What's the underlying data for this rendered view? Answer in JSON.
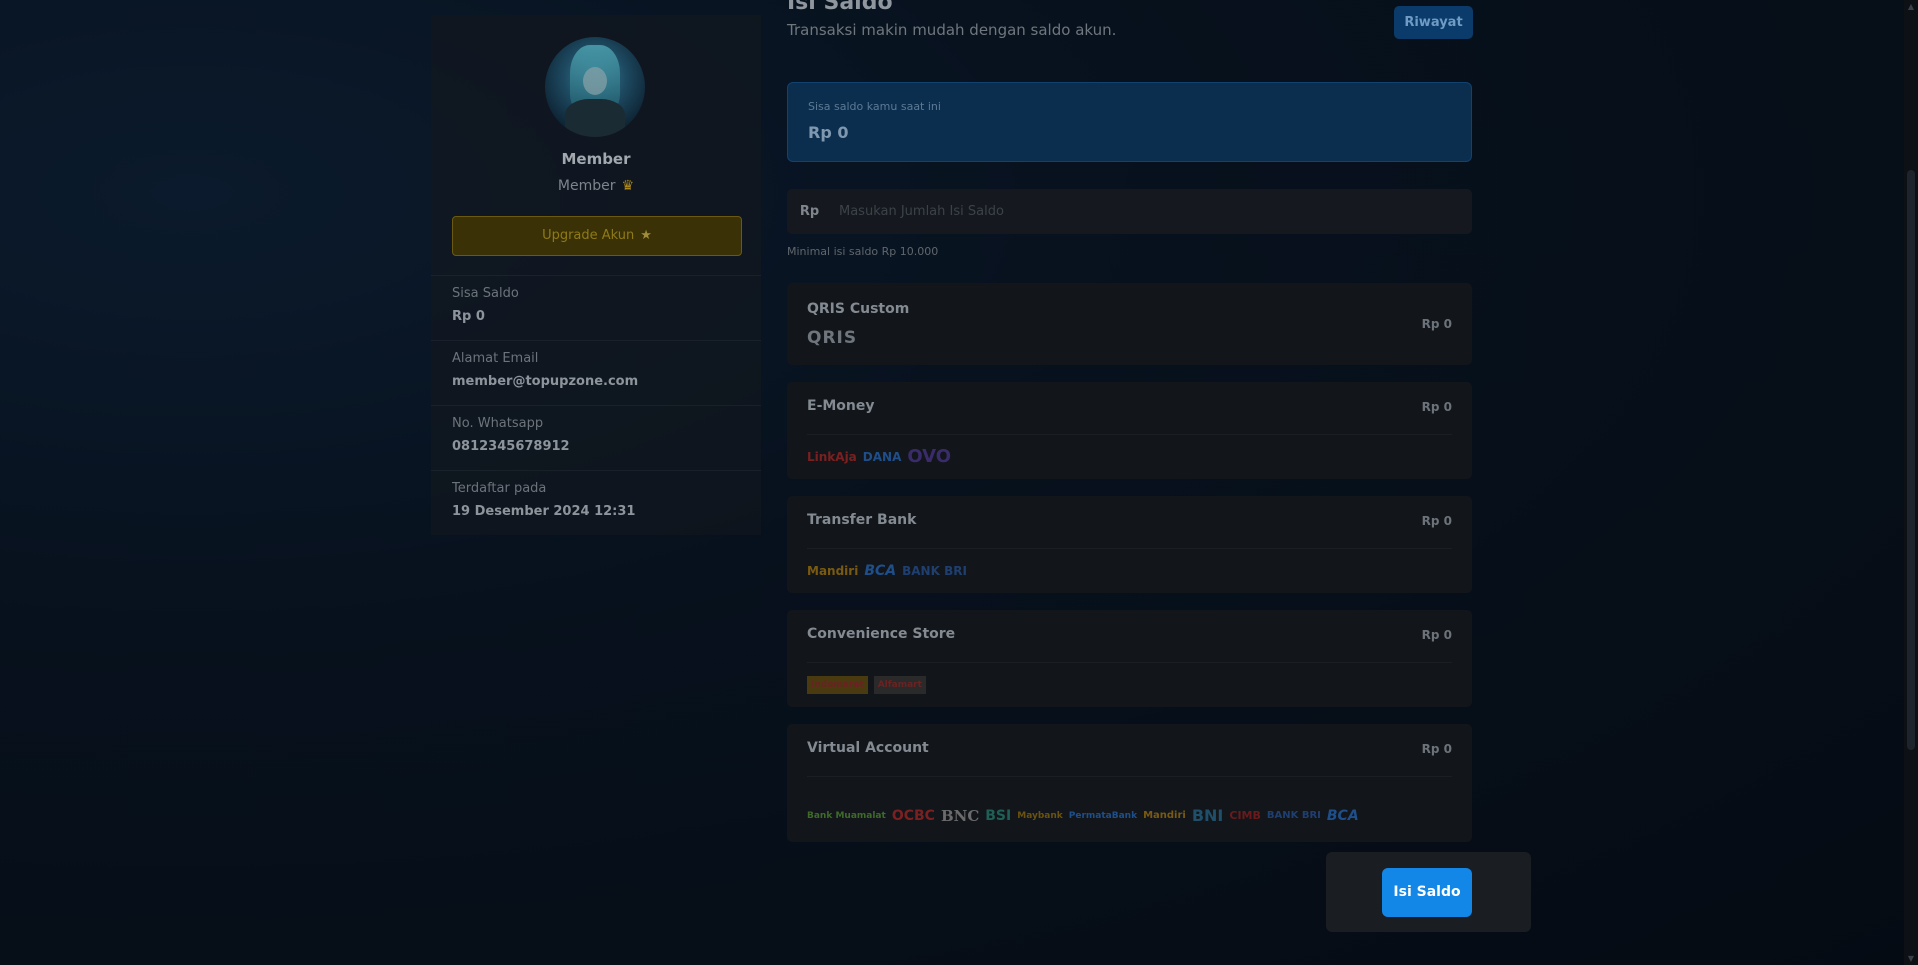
{
  "profile": {
    "name": "Member",
    "role": "Member",
    "upgrade_label": "Upgrade Akun",
    "info": [
      {
        "label": "Sisa Saldo",
        "value": "Rp 0"
      },
      {
        "label": "Alamat Email",
        "value": "member@topupzone.com"
      },
      {
        "label": "No. Whatsapp",
        "value": "0812345678912"
      },
      {
        "label": "Terdaftar pada",
        "value": "19 Desember 2024 12:31"
      }
    ]
  },
  "header": {
    "title": "Isi Saldo",
    "subtitle": "Transaksi makin mudah dengan saldo akun.",
    "history_label": "Riwayat"
  },
  "balance": {
    "label": "Sisa saldo kamu saat ini",
    "value": "Rp 0"
  },
  "amount": {
    "prefix": "Rp",
    "placeholder": "Masukan Jumlah Isi Saldo",
    "value": "",
    "min_note": "Minimal isi saldo Rp 10.000"
  },
  "methods": [
    {
      "title": "QRIS Custom",
      "price": "Rp 0",
      "logos": [
        "QRIS"
      ]
    },
    {
      "title": "E-Money",
      "price": "Rp 0",
      "logos": [
        "LinkAja",
        "DANA",
        "OVO"
      ]
    },
    {
      "title": "Transfer Bank",
      "price": "Rp 0",
      "logos": [
        "Mandiri",
        "BCA",
        "BANK BRI"
      ]
    },
    {
      "title": "Convenience Store",
      "price": "Rp 0",
      "logos": [
        "Indomaret",
        "Alfamart"
      ]
    },
    {
      "title": "Virtual Account",
      "price": "Rp 0",
      "logos": [
        "Bank Muamalat",
        "OCBC",
        "BNC",
        "BSI",
        "Maybank",
        "PermataBank",
        "Mandiri",
        "BNI",
        "CIMB",
        "BANK BRI",
        "BCA"
      ]
    }
  ],
  "footer": {
    "submit_label": "Isi Saldo"
  },
  "colors": {
    "accent": "#1287e8",
    "gold": "#b08a1a"
  }
}
